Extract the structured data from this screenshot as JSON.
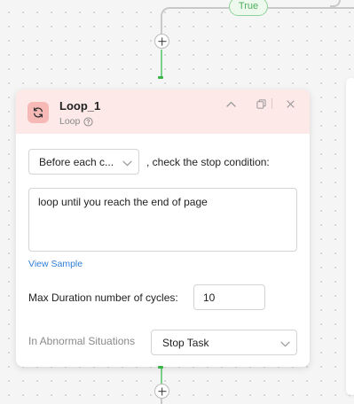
{
  "canvas": {
    "true_label": "True"
  },
  "node": {
    "title": "Loop_1",
    "subtitle": "Loop",
    "icon": "loop-icon",
    "accent_color": "#fde9e8",
    "icon_bg_color": "#f7b9b5",
    "header_buttons": [
      "chevron-up-icon",
      "copy-icon",
      "close-icon"
    ]
  },
  "condition": {
    "timing_value": "Before each c...",
    "check_text": ", check the stop condition:",
    "condition_text": "loop until you reach the end of page",
    "view_sample_label": "View Sample"
  },
  "max_duration": {
    "label": "Max Duration number of cycles:",
    "value": "10"
  },
  "abnormal": {
    "label": "In Abnormal Situations",
    "value": "Stop Task"
  }
}
